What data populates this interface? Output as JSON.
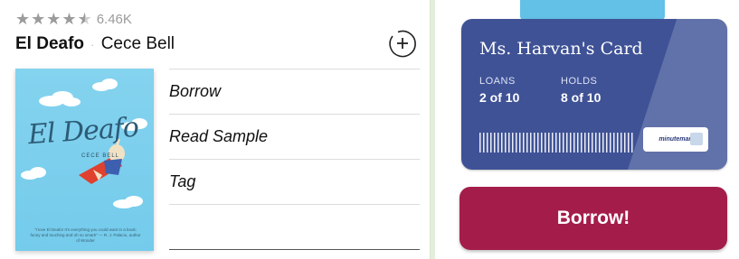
{
  "book": {
    "rating_count": "6.46K",
    "rating_stars": 4.5,
    "title": "El Deafo",
    "separator": "·",
    "author": "Cece Bell",
    "add_icon": "plus-circle-icon"
  },
  "cover": {
    "title": "El Deafo",
    "author": "CECE BELL",
    "quote": "\"I love El Deafo! It's everything you could want in a book: funny and touching and oh so smart!\" — R. J. Palacio, author of Wonder"
  },
  "menu": {
    "items": [
      {
        "label": "Borrow"
      },
      {
        "label": "Read Sample"
      },
      {
        "label": "Tag"
      }
    ]
  },
  "card": {
    "name": "Ms. Harvan's Card",
    "loans_label": "LOANS",
    "loans_value": "2 of 10",
    "holds_label": "HOLDS",
    "holds_value": "8 of 10",
    "library_logo": "minuteman"
  },
  "action": {
    "borrow_label": "Borrow!"
  },
  "colors": {
    "card_bg": "#3f5296",
    "borrow_bg": "#a41d4a",
    "page_bg": "#e3eedc",
    "cover_bg": "#84d3ef"
  }
}
